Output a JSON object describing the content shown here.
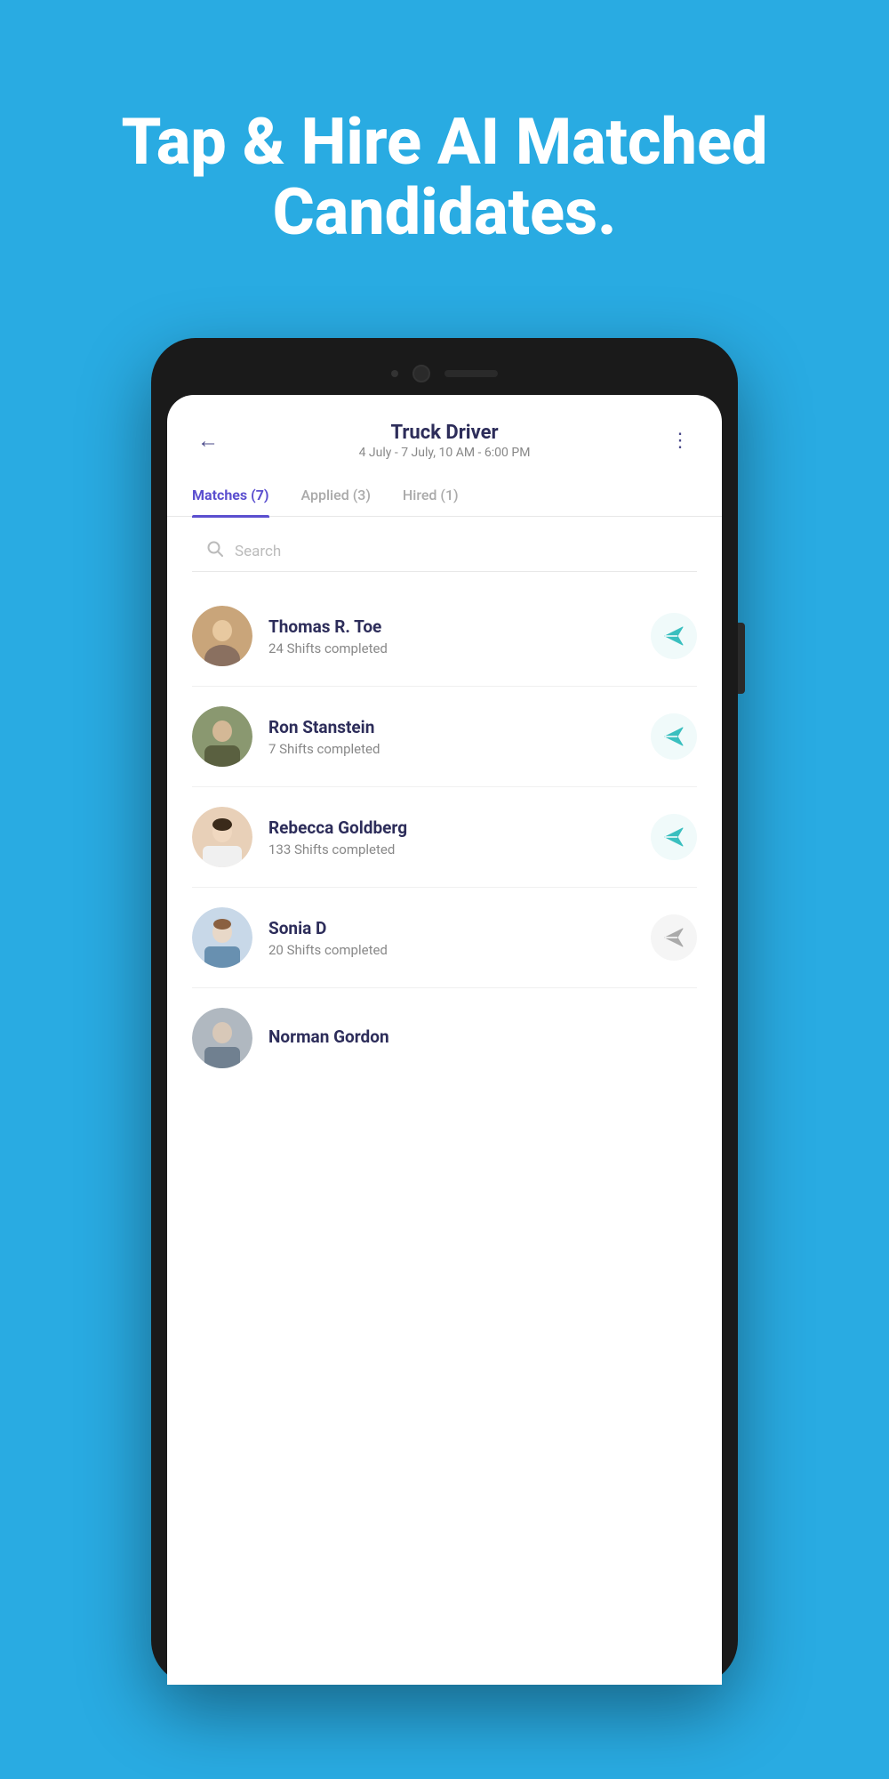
{
  "hero": {
    "headline": "Tap & Hire AI Matched Candidates."
  },
  "app": {
    "header": {
      "back_label": "←",
      "job_title": "Truck Driver",
      "job_date": "4 July - 7 July, 10 AM - 6:00 PM",
      "more_label": "⋮"
    },
    "tabs": [
      {
        "label": "Matches (7)",
        "active": true
      },
      {
        "label": "Applied (3)",
        "active": false
      },
      {
        "label": "Hired (1)",
        "active": false
      }
    ],
    "search": {
      "placeholder": "Search"
    },
    "candidates": [
      {
        "name": "Thomas R. Toe",
        "shifts": "24 Shifts completed",
        "send_active": true,
        "avatar_color_top": "#b0905a",
        "avatar_color_bottom": "#8a7060"
      },
      {
        "name": "Ron Stanstein",
        "shifts": "7 Shifts completed",
        "send_active": true,
        "avatar_color_top": "#7a8a60",
        "avatar_color_bottom": "#5a6040"
      },
      {
        "name": "Rebecca Goldberg",
        "shifts": "133 Shifts completed",
        "send_active": true,
        "avatar_color_top": "#c8a080",
        "avatar_color_bottom": "#a07860"
      },
      {
        "name": "Sonia D",
        "shifts": "20 Shifts completed",
        "send_active": false,
        "avatar_color_top": "#b8c8d8",
        "avatar_color_bottom": "#8898a8"
      },
      {
        "name": "Norman Gordon",
        "shifts": "",
        "send_active": false,
        "avatar_color_top": "#aaaaaa",
        "avatar_color_bottom": "#888888",
        "partial": true
      }
    ]
  },
  "colors": {
    "bg": "#29abe2",
    "active_tab": "#5b4fcf",
    "teal_send": "#3abfbf"
  }
}
